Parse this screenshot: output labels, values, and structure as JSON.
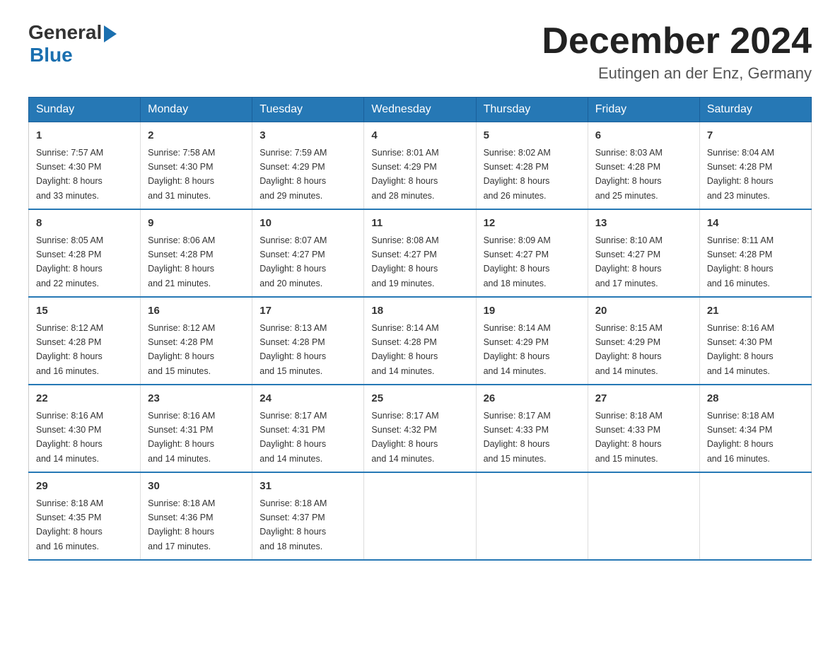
{
  "header": {
    "logo_general": "General",
    "logo_blue": "Blue",
    "month_title": "December 2024",
    "location": "Eutingen an der Enz, Germany"
  },
  "days_of_week": [
    "Sunday",
    "Monday",
    "Tuesday",
    "Wednesday",
    "Thursday",
    "Friday",
    "Saturday"
  ],
  "weeks": [
    [
      {
        "day": "1",
        "sunrise": "7:57 AM",
        "sunset": "4:30 PM",
        "daylight": "8 hours and 33 minutes."
      },
      {
        "day": "2",
        "sunrise": "7:58 AM",
        "sunset": "4:30 PM",
        "daylight": "8 hours and 31 minutes."
      },
      {
        "day": "3",
        "sunrise": "7:59 AM",
        "sunset": "4:29 PM",
        "daylight": "8 hours and 29 minutes."
      },
      {
        "day": "4",
        "sunrise": "8:01 AM",
        "sunset": "4:29 PM",
        "daylight": "8 hours and 28 minutes."
      },
      {
        "day": "5",
        "sunrise": "8:02 AM",
        "sunset": "4:28 PM",
        "daylight": "8 hours and 26 minutes."
      },
      {
        "day": "6",
        "sunrise": "8:03 AM",
        "sunset": "4:28 PM",
        "daylight": "8 hours and 25 minutes."
      },
      {
        "day": "7",
        "sunrise": "8:04 AM",
        "sunset": "4:28 PM",
        "daylight": "8 hours and 23 minutes."
      }
    ],
    [
      {
        "day": "8",
        "sunrise": "8:05 AM",
        "sunset": "4:28 PM",
        "daylight": "8 hours and 22 minutes."
      },
      {
        "day": "9",
        "sunrise": "8:06 AM",
        "sunset": "4:28 PM",
        "daylight": "8 hours and 21 minutes."
      },
      {
        "day": "10",
        "sunrise": "8:07 AM",
        "sunset": "4:27 PM",
        "daylight": "8 hours and 20 minutes."
      },
      {
        "day": "11",
        "sunrise": "8:08 AM",
        "sunset": "4:27 PM",
        "daylight": "8 hours and 19 minutes."
      },
      {
        "day": "12",
        "sunrise": "8:09 AM",
        "sunset": "4:27 PM",
        "daylight": "8 hours and 18 minutes."
      },
      {
        "day": "13",
        "sunrise": "8:10 AM",
        "sunset": "4:27 PM",
        "daylight": "8 hours and 17 minutes."
      },
      {
        "day": "14",
        "sunrise": "8:11 AM",
        "sunset": "4:28 PM",
        "daylight": "8 hours and 16 minutes."
      }
    ],
    [
      {
        "day": "15",
        "sunrise": "8:12 AM",
        "sunset": "4:28 PM",
        "daylight": "8 hours and 16 minutes."
      },
      {
        "day": "16",
        "sunrise": "8:12 AM",
        "sunset": "4:28 PM",
        "daylight": "8 hours and 15 minutes."
      },
      {
        "day": "17",
        "sunrise": "8:13 AM",
        "sunset": "4:28 PM",
        "daylight": "8 hours and 15 minutes."
      },
      {
        "day": "18",
        "sunrise": "8:14 AM",
        "sunset": "4:28 PM",
        "daylight": "8 hours and 14 minutes."
      },
      {
        "day": "19",
        "sunrise": "8:14 AM",
        "sunset": "4:29 PM",
        "daylight": "8 hours and 14 minutes."
      },
      {
        "day": "20",
        "sunrise": "8:15 AM",
        "sunset": "4:29 PM",
        "daylight": "8 hours and 14 minutes."
      },
      {
        "day": "21",
        "sunrise": "8:16 AM",
        "sunset": "4:30 PM",
        "daylight": "8 hours and 14 minutes."
      }
    ],
    [
      {
        "day": "22",
        "sunrise": "8:16 AM",
        "sunset": "4:30 PM",
        "daylight": "8 hours and 14 minutes."
      },
      {
        "day": "23",
        "sunrise": "8:16 AM",
        "sunset": "4:31 PM",
        "daylight": "8 hours and 14 minutes."
      },
      {
        "day": "24",
        "sunrise": "8:17 AM",
        "sunset": "4:31 PM",
        "daylight": "8 hours and 14 minutes."
      },
      {
        "day": "25",
        "sunrise": "8:17 AM",
        "sunset": "4:32 PM",
        "daylight": "8 hours and 14 minutes."
      },
      {
        "day": "26",
        "sunrise": "8:17 AM",
        "sunset": "4:33 PM",
        "daylight": "8 hours and 15 minutes."
      },
      {
        "day": "27",
        "sunrise": "8:18 AM",
        "sunset": "4:33 PM",
        "daylight": "8 hours and 15 minutes."
      },
      {
        "day": "28",
        "sunrise": "8:18 AM",
        "sunset": "4:34 PM",
        "daylight": "8 hours and 16 minutes."
      }
    ],
    [
      {
        "day": "29",
        "sunrise": "8:18 AM",
        "sunset": "4:35 PM",
        "daylight": "8 hours and 16 minutes."
      },
      {
        "day": "30",
        "sunrise": "8:18 AM",
        "sunset": "4:36 PM",
        "daylight": "8 hours and 17 minutes."
      },
      {
        "day": "31",
        "sunrise": "8:18 AM",
        "sunset": "4:37 PM",
        "daylight": "8 hours and 18 minutes."
      },
      null,
      null,
      null,
      null
    ]
  ],
  "labels": {
    "sunrise": "Sunrise:",
    "sunset": "Sunset:",
    "daylight": "Daylight:"
  }
}
